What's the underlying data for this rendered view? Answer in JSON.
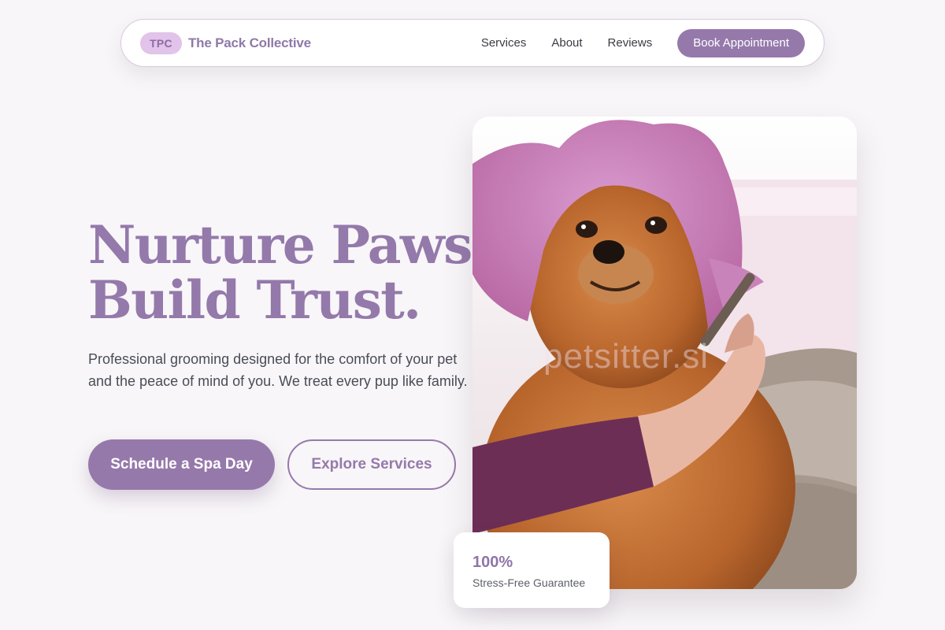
{
  "nav": {
    "logo_badge": "TPC",
    "brand": "The Pack Collective",
    "links": [
      "Services",
      "About",
      "Reviews"
    ],
    "cta": "Book Appointment"
  },
  "hero": {
    "headline_line1": "Nurture Paws,",
    "headline_line2": "Build Trust.",
    "subtext": "Professional grooming designed for the comfort of your pet and the peace of mind of you. We treat every pup like family.",
    "primary_button": "Schedule a Spa Day",
    "secondary_button": "Explore Services"
  },
  "image": {
    "watermark": "petsitter.si"
  },
  "stat": {
    "value": "100%",
    "label": "Stress-Free Guarantee"
  },
  "colors": {
    "accent": "#9679ab",
    "badge_bg": "#e2c3ea",
    "background": "#f8f6f8"
  }
}
